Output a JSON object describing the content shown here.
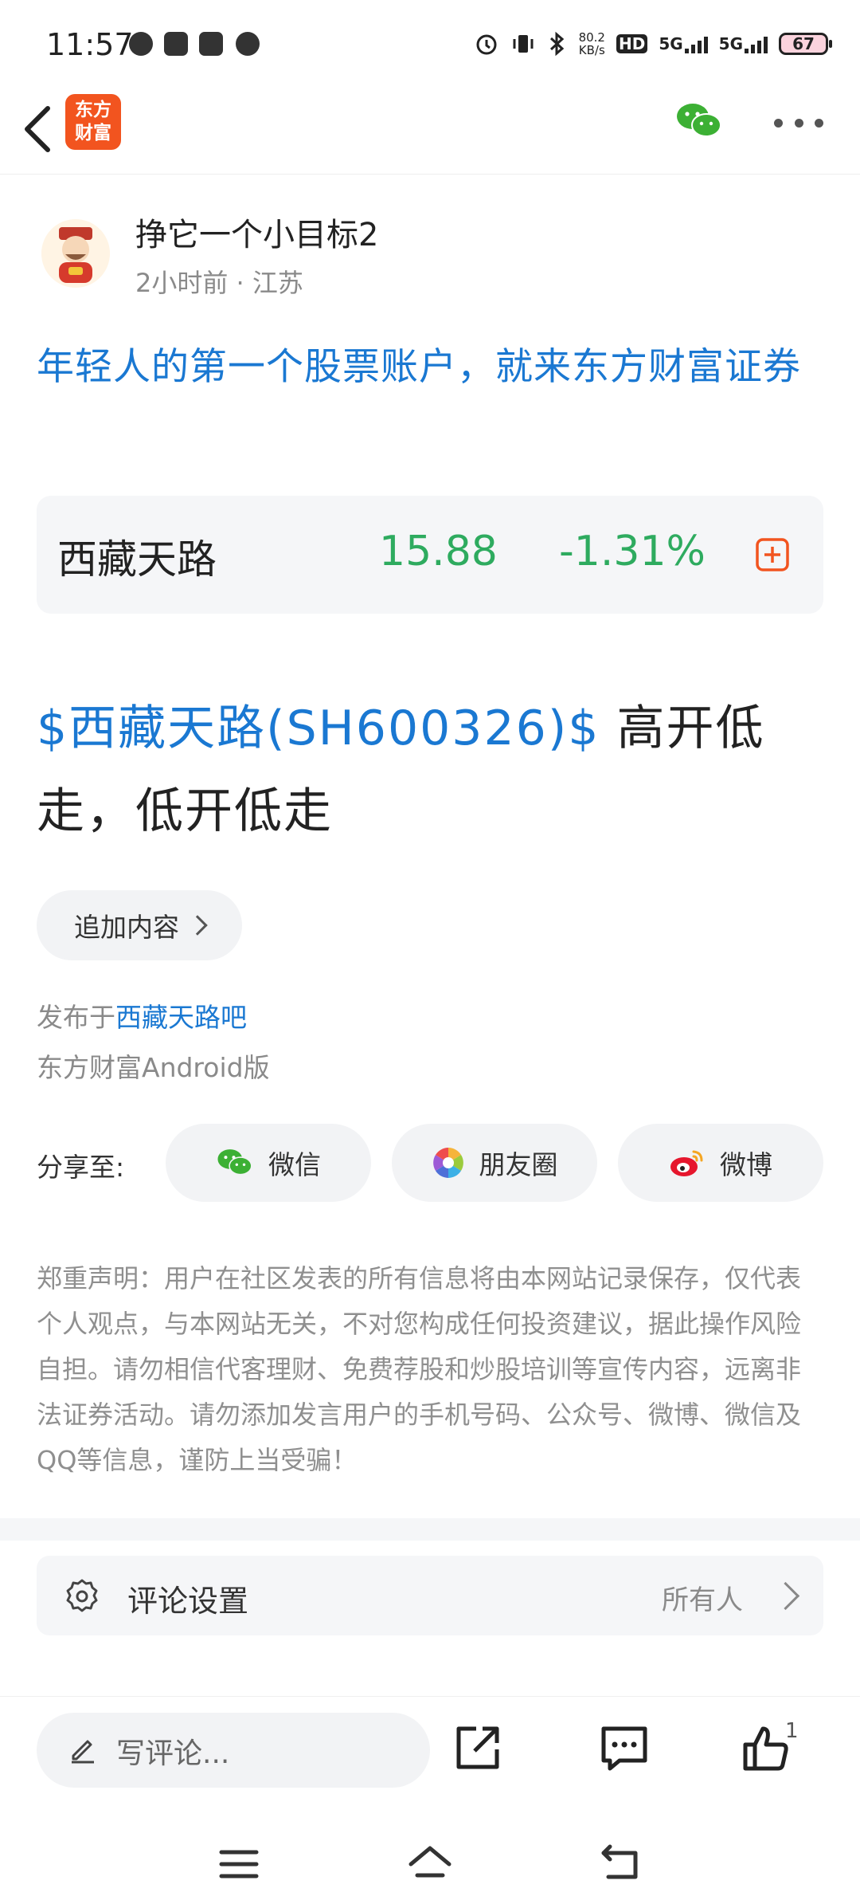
{
  "status_bar": {
    "time": "11:57",
    "net_speed_top": "80.2",
    "net_speed_bottom": "KB/s",
    "hd_label": "HD",
    "sim1": "5G",
    "sim2": "5G",
    "battery": "67"
  },
  "nav": {
    "back_icon": "chevron-left-icon",
    "logo_text_line1": "东方",
    "logo_text_line2": "财富",
    "share_icon": "wechat-icon",
    "more_icon": "more-dots-icon"
  },
  "author": {
    "name": "挣它一个小目标2",
    "time": "2小时前",
    "location": "江苏"
  },
  "ad_title": "年轻人的第一个股票账户，就来东方财富证券",
  "stock_card": {
    "name": "西藏天路",
    "price": "15.88",
    "change": "-1.31%",
    "price_color": "#2eab5f",
    "accent": "#f2541f"
  },
  "post": {
    "stock_link": "$西藏天路(SH600326)$",
    "title_rest": " 高开低走，低开低走"
  },
  "append_button": "追加内容",
  "publish": {
    "prefix": "发布于",
    "bar_name": "西藏天路吧",
    "client": "东方财富Android版"
  },
  "share": {
    "label": "分享至:",
    "wechat": "微信",
    "moments": "朋友圈",
    "weibo": "微博"
  },
  "disclaimer": "郑重声明：用户在社区发表的所有信息将由本网站记录保存，仅代表个人观点，与本网站无关，不对您构成任何投资建议，据此操作风险自担。请勿相信代客理财、免费荐股和炒股培训等宣传内容，远离非法证券活动。请勿添加发言用户的手机号码、公众号、微博、微信及QQ等信息，谨防上当受骗！",
  "comment_settings": {
    "label": "评论设置",
    "value": "所有人"
  },
  "bottom": {
    "comment_placeholder": "写评论...",
    "like_count": "1"
  },
  "colors": {
    "link": "#1a78d2",
    "brand": "#f2541f",
    "down_green": "#2eab5f"
  }
}
